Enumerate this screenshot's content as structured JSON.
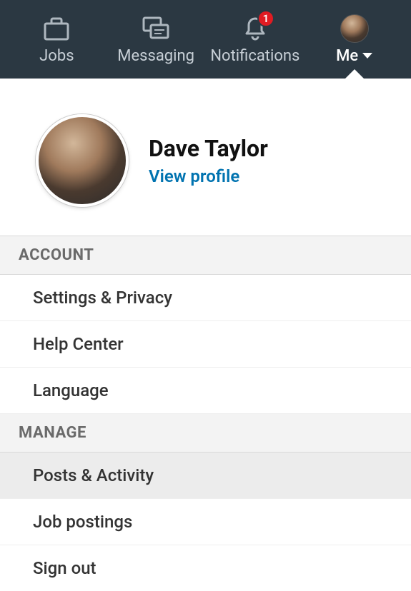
{
  "nav": {
    "jobs": {
      "label": "Jobs"
    },
    "messaging": {
      "label": "Messaging"
    },
    "notifications": {
      "label": "Notifications",
      "badge": "1"
    },
    "me": {
      "label": "Me"
    }
  },
  "profile": {
    "name": "Dave Taylor",
    "view_profile": "View profile"
  },
  "sections": {
    "account": {
      "header": "ACCOUNT",
      "items": [
        "Settings & Privacy",
        "Help Center",
        "Language"
      ]
    },
    "manage": {
      "header": "MANAGE",
      "items": [
        "Posts & Activity",
        "Job postings",
        "Sign out"
      ]
    }
  }
}
